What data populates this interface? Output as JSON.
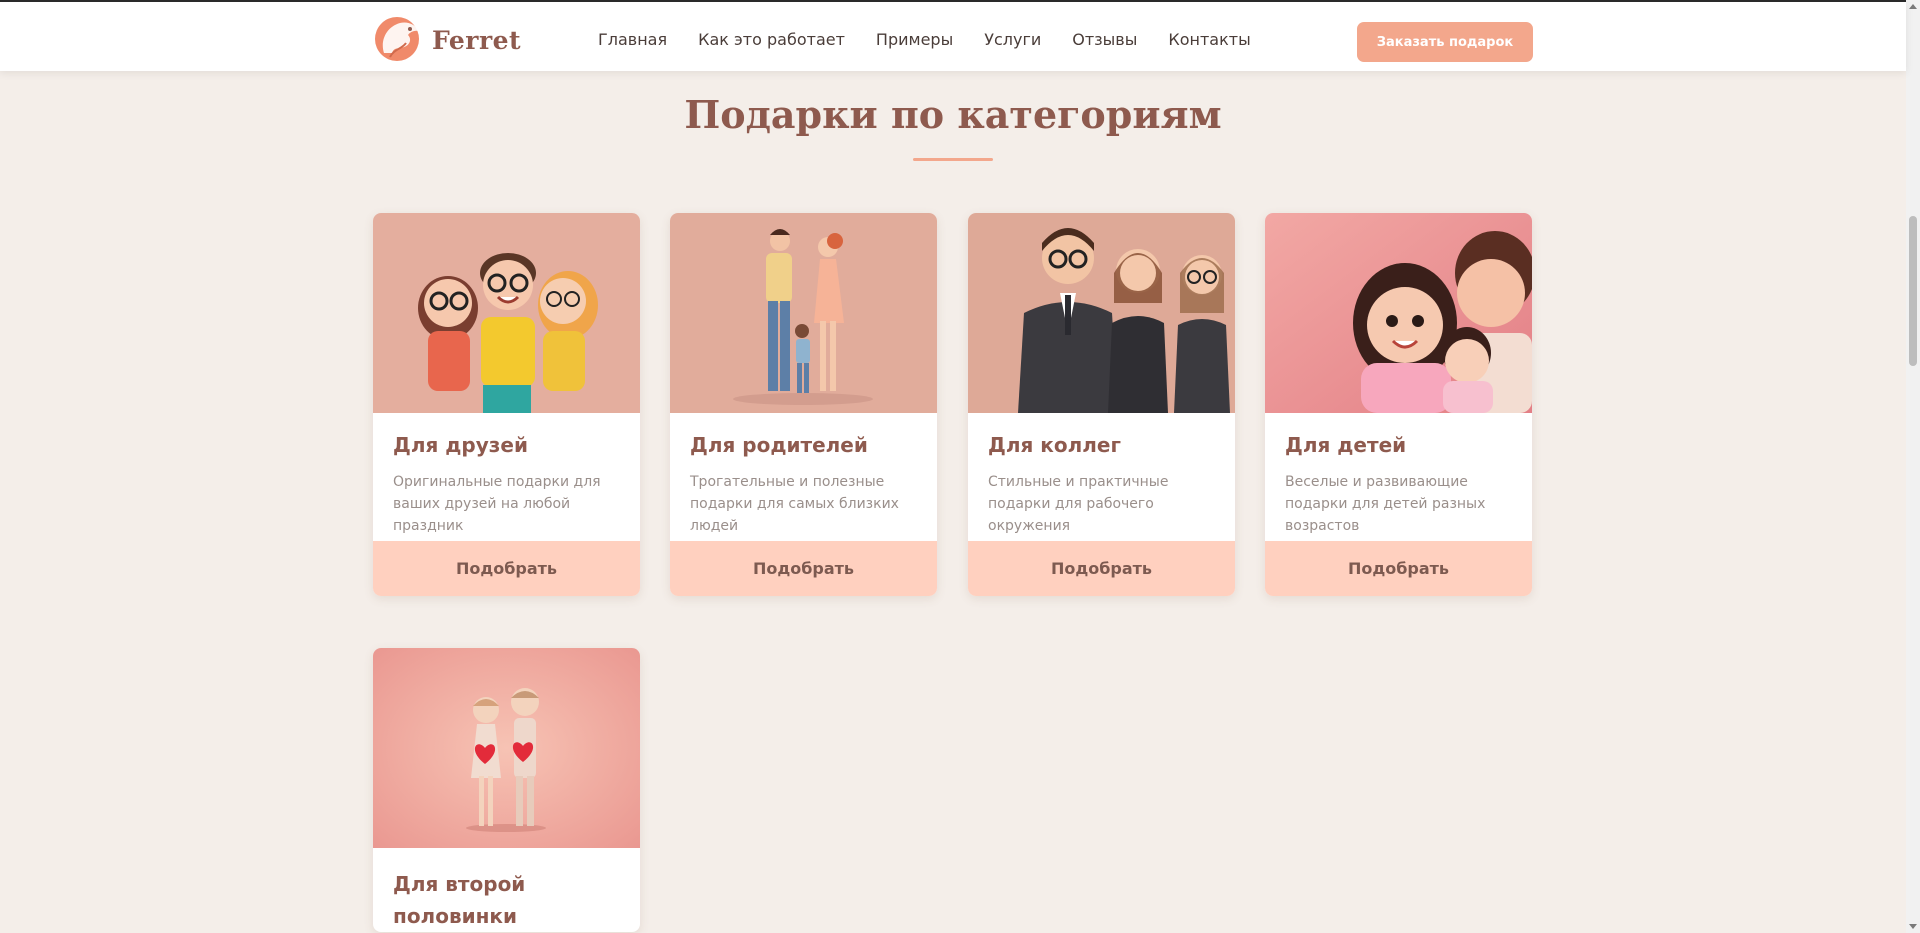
{
  "brand": {
    "name": "Ferret",
    "logo_icon": "ferret-logo-icon",
    "accent_color": "#f3a78c",
    "title_color": "#8e5a4e"
  },
  "nav": {
    "items": [
      {
        "label": "Главная"
      },
      {
        "label": "Как это работает"
      },
      {
        "label": "Примеры"
      },
      {
        "label": "Услуги"
      },
      {
        "label": "Отзывы"
      },
      {
        "label": "Контакты"
      }
    ],
    "order_button": "Заказать подарок"
  },
  "section": {
    "title": "Подарки по категориям"
  },
  "categories": [
    {
      "title": "Для друзей",
      "description": "Оригинальные подарки для ваших друзей на любой праздник",
      "button": "Подобрать",
      "image": "friends-illustration"
    },
    {
      "title": "Для родителей",
      "description": "Трогательные и полезные подарки для самых близких людей",
      "button": "Подобрать",
      "image": "parents-illustration"
    },
    {
      "title": "Для коллег",
      "description": "Стильные и практичные подарки для рабочего окружения",
      "button": "Подобрать",
      "image": "colleagues-illustration"
    },
    {
      "title": "Для детей",
      "description": "Веселые и развивающие подарки для детей разных возрастов",
      "button": "Подобрать",
      "image": "kids-illustration"
    },
    {
      "title": "Для второй половинки",
      "image": "couple-illustration"
    }
  ]
}
